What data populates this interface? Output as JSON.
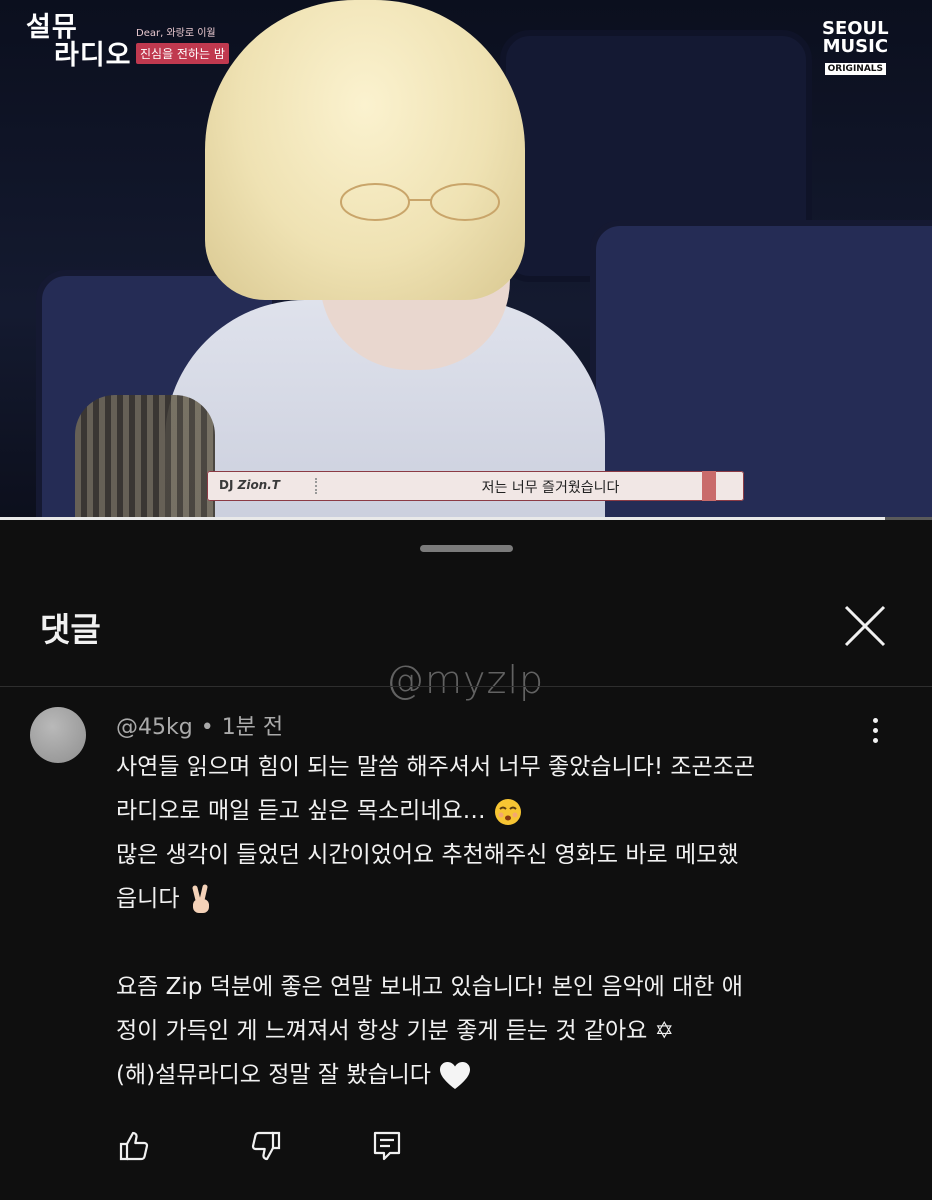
{
  "video": {
    "show_title_line1": "설뮤",
    "show_title_line2": "라디오",
    "show_sub_top": "Dear, 와랑로 이월",
    "show_sub_bottom": "진심을 전하는 밤",
    "brand_line1": "SEOUL",
    "brand_line2": "MUSIC",
    "brand_tag": "ORIGINALS",
    "caption_dj_prefix": "DJ",
    "caption_dj_name": "Zion.T",
    "caption_text": "저는 너무 즐거웠습니다",
    "progress_fraction": 0.95
  },
  "sheet": {
    "title": "댓글",
    "watermark": "@myzlp"
  },
  "comment": {
    "author": "@45kg",
    "separator": "•",
    "time": "1분 전",
    "lines": [
      "사연들 읽으며 힘이 되는 말씀 해주셔서 너무 좋았습니다! 조곤조곤",
      "라디오로 매일 듣고 싶은 목소리네요…",
      "많은 생각이 들었던 시간이었어요 추천해주신 영화도 바로 메모했",
      "읍니다",
      "",
      "요즘 Zip 덕분에 좋은 연말 보내고 있습니다! 본인 음악에 대한 애",
      "정이 가득인 게 느껴져서 항상 기분 좋게 듣는 것 같아요 ✡",
      "(해)설뮤라디오 정말 잘 봤습니다"
    ]
  },
  "icons": {
    "close": "close-icon",
    "more": "more-vert-icon",
    "like": "thumbs-up-icon",
    "dislike": "thumbs-down-icon",
    "reply": "reply-icon"
  }
}
